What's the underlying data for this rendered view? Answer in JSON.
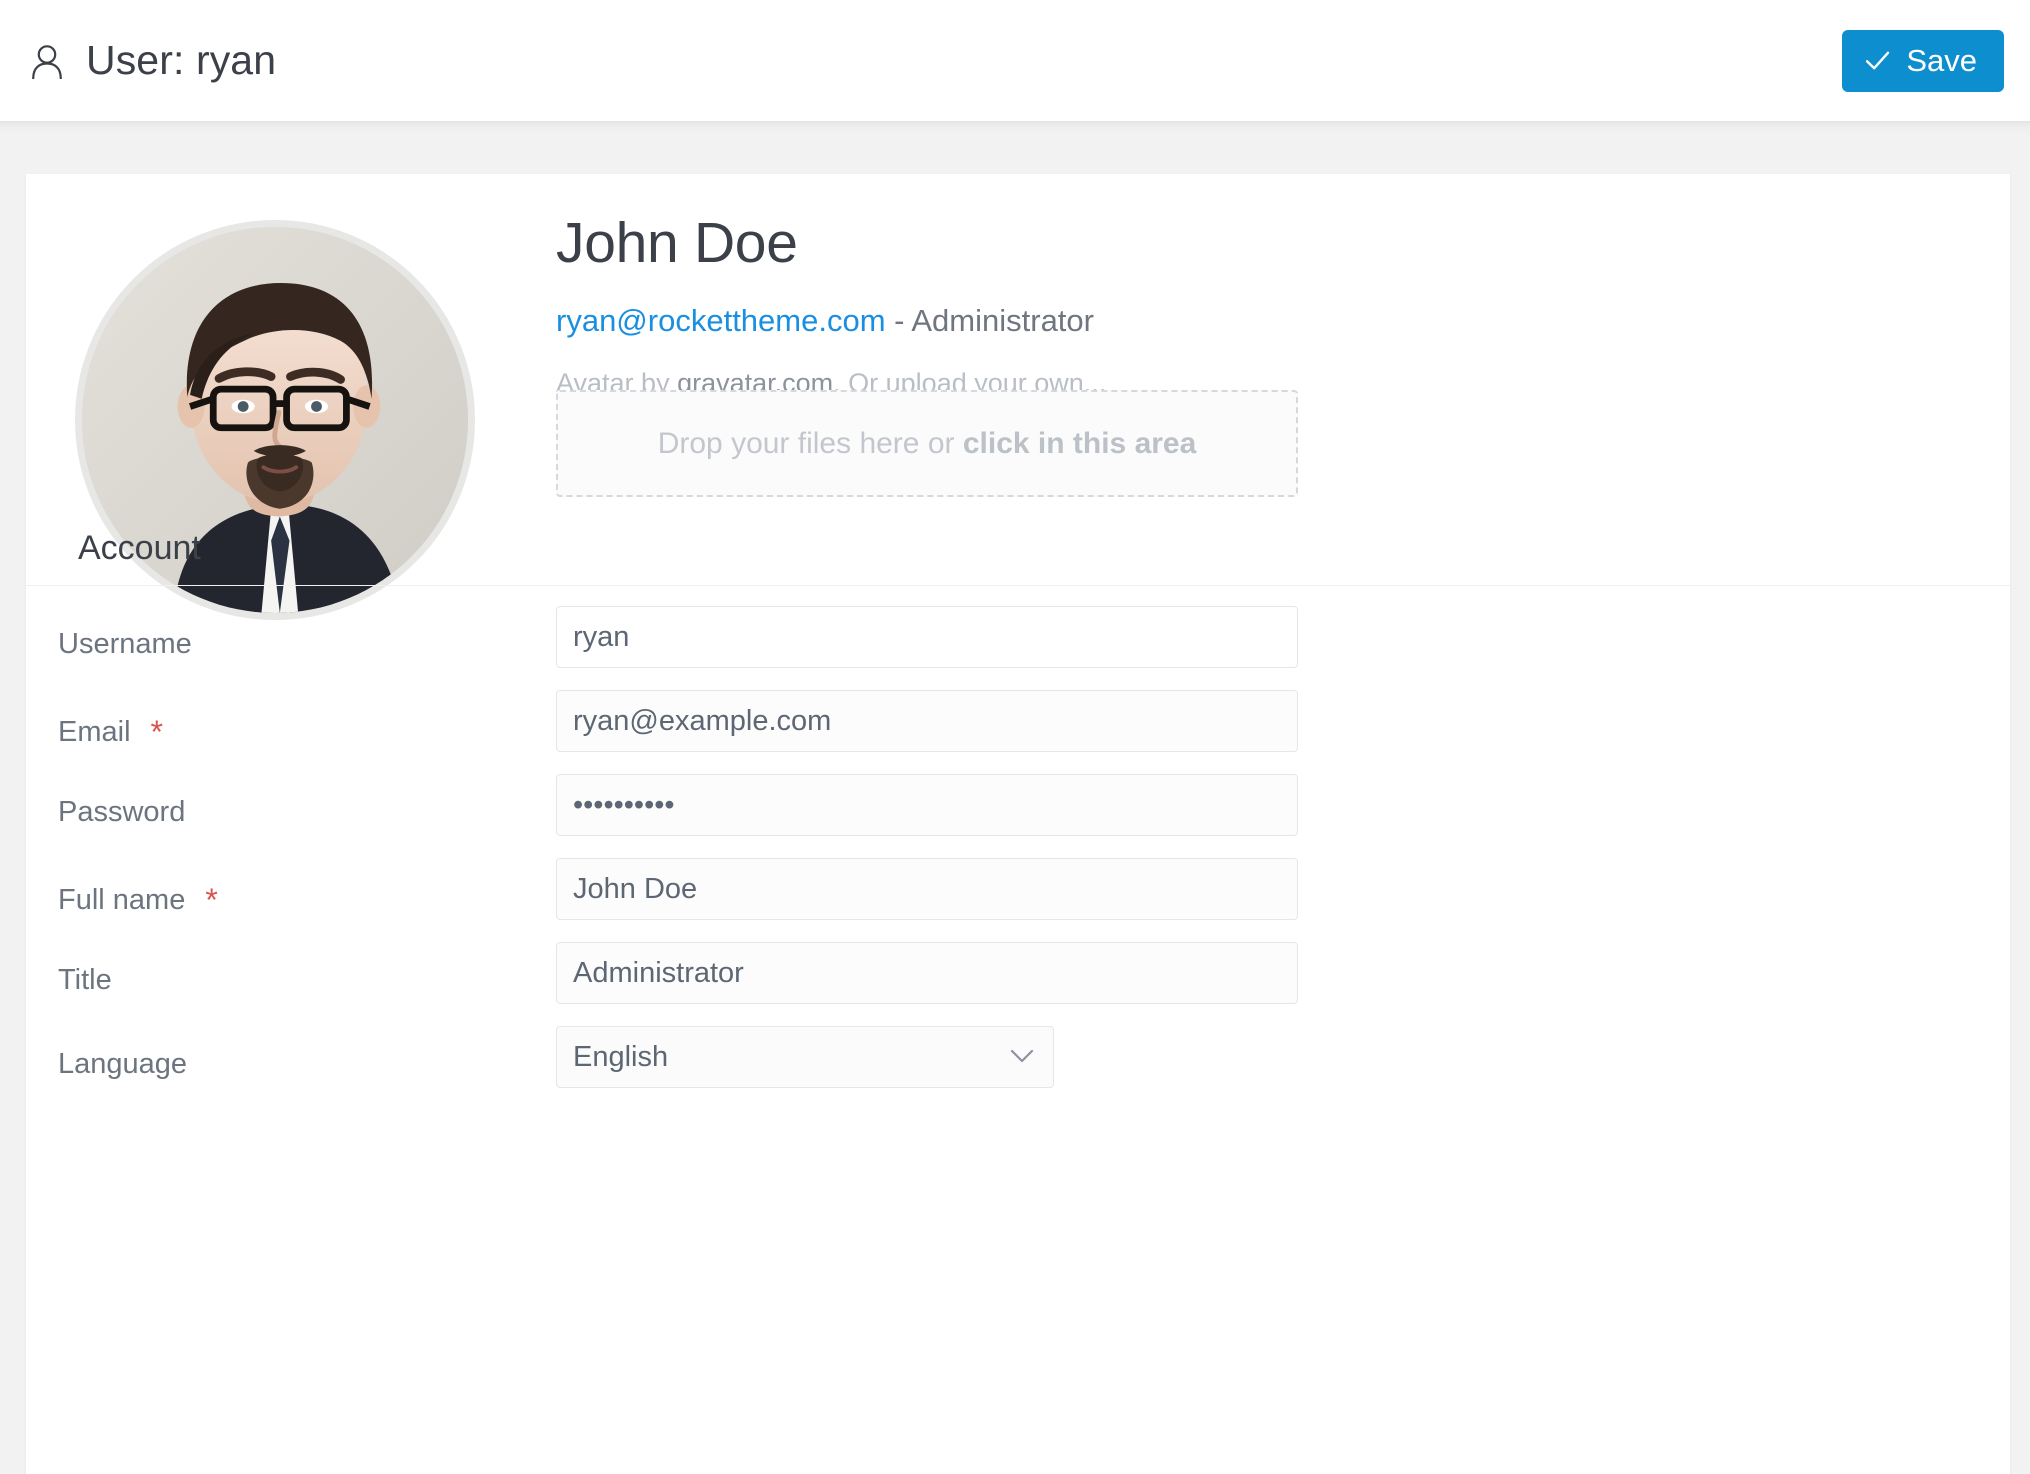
{
  "header": {
    "user_icon": "person-icon",
    "title": "User: ryan",
    "save_icon": "check-icon",
    "save_label": "Save"
  },
  "profile": {
    "avatar_icon": "avatar-photo",
    "name": "John Doe",
    "email": "ryan@rockettheme.com",
    "role_separator": " - ",
    "role": "Administrator",
    "avatar_note_prefix": "Avatar by ",
    "avatar_note_link": "gravatar.com",
    "avatar_note_suffix": ". Or upload your own...",
    "dropzone_text": "Drop your files here or ",
    "dropzone_text_bold": "click in this area"
  },
  "account": {
    "section_title": "Account",
    "fields": [
      {
        "label": "Username",
        "required": "",
        "value": "ryan",
        "type": "text"
      },
      {
        "label": "Email",
        "required": "*",
        "value": "ryan@example.com",
        "type": "text"
      },
      {
        "label": "Password",
        "required": "",
        "value": "••••••••••",
        "type": "password"
      },
      {
        "label": "Full name",
        "required": "*",
        "value": "John Doe",
        "type": "text"
      },
      {
        "label": "Title",
        "required": "",
        "value": "Administrator",
        "type": "text"
      },
      {
        "label": "Language",
        "required": "",
        "value": "English",
        "type": "select"
      }
    ],
    "language_options": [
      "English"
    ]
  },
  "colors": {
    "accent_blue": "#0d8ecf",
    "link_blue": "#1a8fe0",
    "required_red": "#d9534f",
    "label_gray": "#6c757f",
    "page_bg": "#f2f2f2"
  }
}
